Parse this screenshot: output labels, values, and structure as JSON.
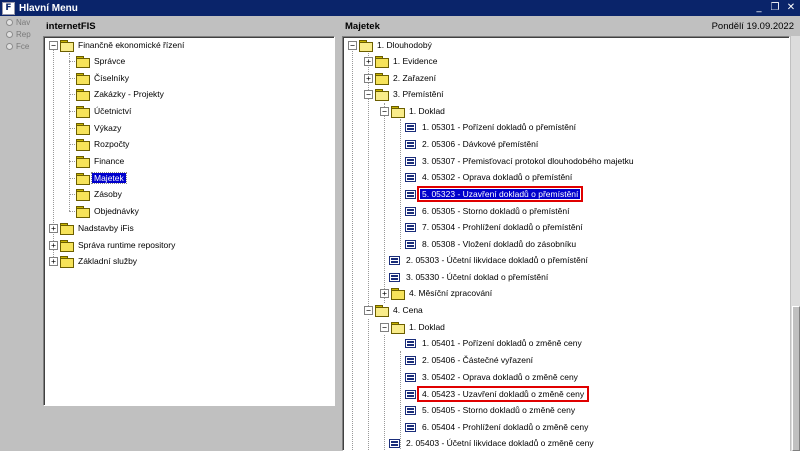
{
  "window": {
    "title": "Hlavní Menu",
    "app_icon": "F",
    "controls": [
      "_",
      "❐",
      "✕"
    ]
  },
  "sidebar": {
    "options": [
      "Nav",
      "Rep",
      "Fce"
    ]
  },
  "left_pane": {
    "header": "internetFIS",
    "items": [
      "Finančně ekonomické řízení",
      "Správce",
      "Číselníky",
      "Zakázky - Projekty",
      "Účetnictví",
      "Výkazy",
      "Rozpočty",
      "Finance",
      "Majetek",
      "Zásoby",
      "Objednávky",
      "Nadstavby iFis",
      "Správa runtime repository",
      "Základní služby"
    ]
  },
  "right_pane": {
    "header": "Majetek",
    "date": "Pondělí 19.09.2022",
    "items": [
      "1.  Dlouhodobý",
      "1.  Evidence",
      "2.  Zařazení",
      "3.  Přemístění",
      "1.  Doklad",
      "1.  05301 - Pořízení dokladů o přemístění",
      "2.  05306 - Dávkové přemístění",
      "3.  05307 - Přemisťovací protokol dlouhodobého majetku",
      "4.  05302 - Oprava dokladů o přemístění",
      "5.  05323 - Uzavření dokladů o přemístění",
      "6.  05305 - Storno dokladů o přemístění",
      "7.  05304 - Prohlížení dokladů o přemístění",
      "8.  05308 - Vložení dokladů do zásobníku",
      "2.  05303 - Účetní likvidace dokladů o přemístění",
      "3.  05330 - Účetní doklad o přemístění",
      "4.  Měsíční zpracování",
      "4.  Cena",
      "1.  Doklad",
      "1.  05401 - Pořízení dokladů o změně ceny",
      "2.  05406 - Částečné vyřazení",
      "3.  05402 - Oprava dokladů o změně ceny",
      "4.  05423 - Uzavření dokladů o změně ceny",
      "5.  05405 - Storno dokladů o změně ceny",
      "6.  05404 - Prohlížení dokladů o změně ceny",
      "2.  05403 - Účetní likvidace dokladů o změně ceny"
    ]
  },
  "colors": {
    "titlebar": "#0a246a",
    "selection": "#0000cc",
    "highlight_box": "#e00000",
    "folder": "#f6e35a"
  }
}
